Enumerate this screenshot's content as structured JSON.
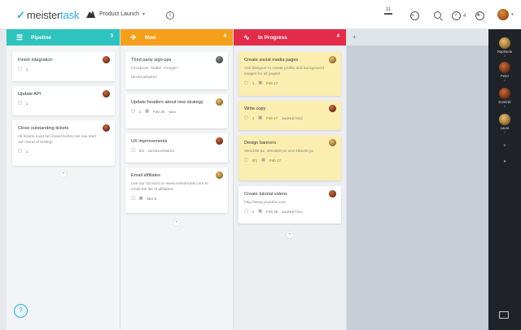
{
  "app": {
    "logo_prefix": "meister",
    "logo_suffix": "task",
    "project_name": "Product Launch"
  },
  "topbar": {
    "count_value": "11"
  },
  "columns": [
    {
      "name": "Pipeline",
      "count": "3",
      "color": "#2ec3bd",
      "icon": "list-icon"
    },
    {
      "name": "Now",
      "count": "4",
      "color": "#f4a01d",
      "icon": "plane-icon"
    },
    {
      "name": "In Progress",
      "count": "4",
      "color": "#e22c4a",
      "icon": "pulse-icon"
    }
  ],
  "pipeline_cards": [
    {
      "title": "Finish integration",
      "comments": "1"
    },
    {
      "title": "Update API",
      "comments": "1"
    },
    {
      "title": "Close outstanding tickets",
      "desc": "All tickets must be closed before we can start our round of testing!",
      "comments": "1"
    }
  ],
  "now_cards": [
    {
      "title": "Third party sign-ups",
      "desc": "Facebook, Twitter, Google+",
      "tag": "DEVELOPMENT"
    },
    {
      "title": "Update headers about new strategy",
      "comments": "1",
      "date": "Feb 25",
      "tag": "Web"
    },
    {
      "title": "UX improvements",
      "comments": "0/1",
      "tag": "DEVELOPMENT"
    },
    {
      "title": "Email affiliates",
      "desc": "Use our account on www.meistertask.com to email the list of affiliates!",
      "date": "Mar 6"
    }
  ],
  "progress_cards": [
    {
      "title": "Create social media pages",
      "desc": "Ask designer to create profile and background images for all pages!",
      "comments": "1",
      "date": "Feb 17"
    },
    {
      "title": "Write copy",
      "comments": "1",
      "date": "Feb 17",
      "tag": "MARKETING"
    },
    {
      "title": "Design banners",
      "desc": "300x150 px, 300x600 px and 468x60 px",
      "comments": "0/1",
      "date": "Feb 17"
    },
    {
      "title": "Create tutorial videos",
      "desc": "http://www.youtube.com",
      "comments": "1",
      "date": "Feb 28",
      "tag": "MARKETING"
    }
  ],
  "members": [
    {
      "name": "Raphaela",
      "count": "3"
    },
    {
      "name": "Peter",
      "count": "2"
    },
    {
      "name": "Dominik",
      "count": "2"
    },
    {
      "name": "Laura",
      "count": "2"
    }
  ],
  "topbar_badge": "4"
}
